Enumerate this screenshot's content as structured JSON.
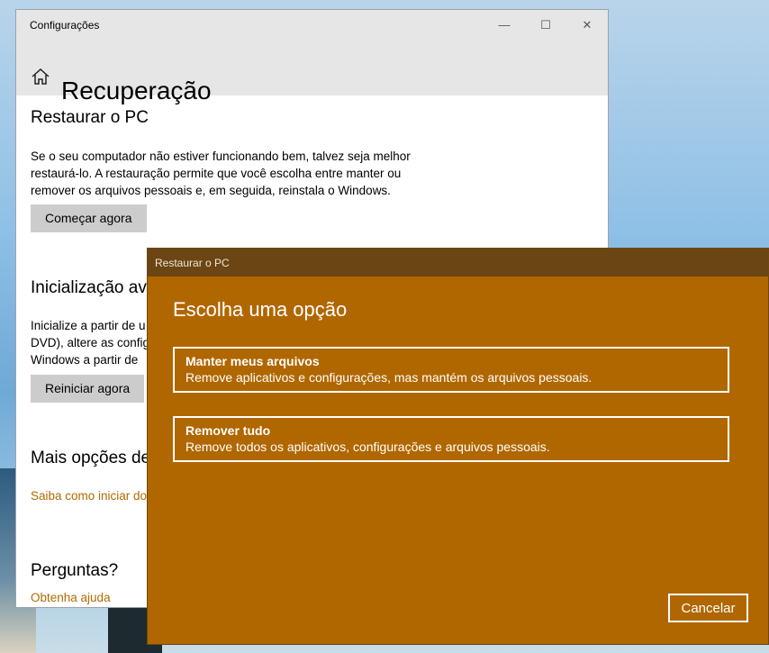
{
  "settings": {
    "window_title": "Configurações",
    "controls": {
      "minimize": "—",
      "maximize": "☐",
      "close": "✕"
    },
    "page_title": "Recuperação",
    "reset": {
      "title": "Restaurar o PC",
      "line1": "Se o seu computador não estiver funcionando bem, talvez seja melhor",
      "line2": "restaurá-lo. A restauração permite que você escolha entre manter ou",
      "line3": "remover os arquivos pessoais e, em seguida, reinstala o Windows.",
      "button": "Começar agora"
    },
    "advanced": {
      "title": "Inicialização av",
      "line1": "Inicialize a partir de u",
      "line2": "DVD), altere as config",
      "line3": "Windows a partir de",
      "button": "Reiniciar agora"
    },
    "more": {
      "title": "Mais opções de",
      "link": "Saiba como iniciar do"
    },
    "questions": {
      "title": "Perguntas?",
      "link": "Obtenha ajuda"
    }
  },
  "dialog": {
    "title": "Restaurar o PC",
    "heading": "Escolha uma opção",
    "options": [
      {
        "title": "Manter meus arquivos",
        "desc": "Remove aplicativos e configurações, mas mantém os arquivos pessoais."
      },
      {
        "title": "Remover tudo",
        "desc": "Remove todos os aplicativos, configurações e arquivos pessoais."
      }
    ],
    "cancel": "Cancelar"
  },
  "colors": {
    "accent": "#b06700",
    "dialog_titlebar": "#6b4513",
    "link": "#b06a00"
  }
}
